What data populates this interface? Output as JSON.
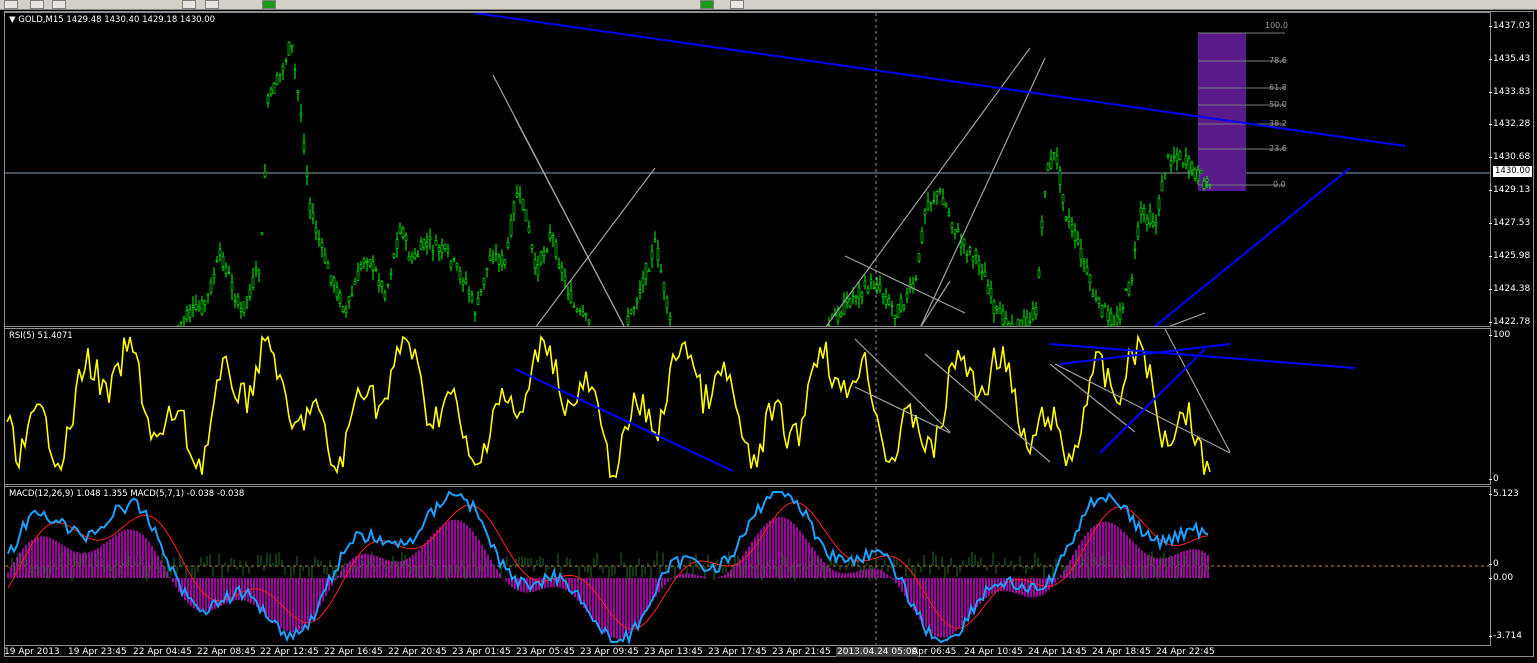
{
  "toolbar": {
    "hint": ""
  },
  "symbol": {
    "label": "GOLD,M15",
    "ohlc": "1429.48 1430.40 1429.18 1430.00",
    "dropdown_glyph": "▼"
  },
  "price_scale": {
    "levels": [
      "1437.03",
      "1435.43",
      "1433.83",
      "1432.28",
      "1430.68",
      "1429.13",
      "1427.53",
      "1425.98",
      "1424.38",
      "1422.78"
    ],
    "current": "1430.00"
  },
  "fibonacci": {
    "levels": [
      "100.0",
      "78.6",
      "61.8",
      "50.0",
      "38.2",
      "23.6",
      "0.0"
    ]
  },
  "rsi": {
    "label": "RSI(5) 51.4071",
    "scale_top": "100",
    "scale_bottom": "0"
  },
  "macd": {
    "label": "MACD(12,26,9) 1.048 1.355  MACD(5,7,1) -0.038 -0.038",
    "scale": [
      "5.123",
      "0",
      "0.00",
      "-3.714"
    ]
  },
  "time_axis": {
    "labels": [
      "19 Apr 2013",
      "19 Apr 23:45",
      "22 Apr 04:45",
      "22 Apr 08:45",
      "22 Apr 12:45",
      "22 Apr 16:45",
      "22 Apr 20:45",
      "23 Apr 01:45",
      "23 Apr 05:45",
      "23 Apr 09:45",
      "23 Apr 13:45",
      "23 Apr 17:45",
      "23 Apr 21:45",
      "Apr 06:45",
      "24 Apr 10:45",
      "24 Apr 14:45",
      "24 Apr 18:45",
      "24 Apr 22:45"
    ],
    "crosshair_label": "2013.04.24 05:00"
  },
  "colors": {
    "candles": "#00ff00",
    "rsi_line": "#ffff00",
    "macd_line": "#1ea0ff",
    "macd_hist": "#a000a0",
    "macd_signal": "#ff2020",
    "trendline": "#0000ff",
    "gray_lines": "#a0a0a0",
    "fib_box": "#5a1a8a"
  }
}
